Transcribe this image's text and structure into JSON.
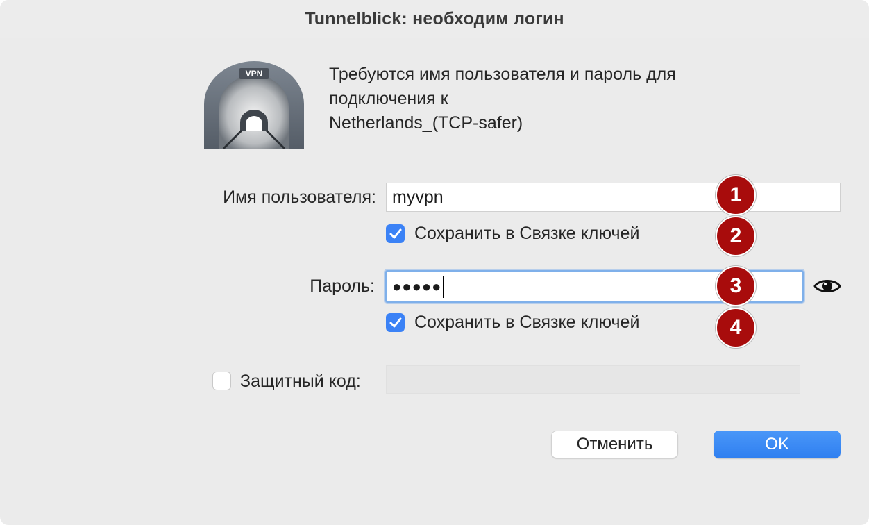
{
  "window": {
    "title": "Tunnelblick: необходим логин"
  },
  "app_icon": {
    "badge_text": "VPN",
    "icon": "tunnelblick-tunnel-icon"
  },
  "message": {
    "line1": "Требуются имя пользователя и пароль для",
    "line2": "подключения к",
    "line3": "Netherlands_(TCP-safer)"
  },
  "username": {
    "label": "Имя пользователя:",
    "value": "myvpn",
    "save_label": "Сохранить в Связке ключей",
    "save_checked": true
  },
  "password": {
    "label": "Пароль:",
    "masked_value": "●●●●●",
    "save_label": "Сохранить в Связке ключей",
    "save_checked": true,
    "reveal_icon": "eye-icon"
  },
  "security_code": {
    "label": "Защитный код:",
    "checked": false,
    "value": ""
  },
  "annotations": [
    "1",
    "2",
    "3",
    "4"
  ],
  "buttons": {
    "cancel": "Отменить",
    "ok": "OK"
  },
  "colors": {
    "accent": "#3b82f6",
    "badge": "#a80c0c"
  }
}
